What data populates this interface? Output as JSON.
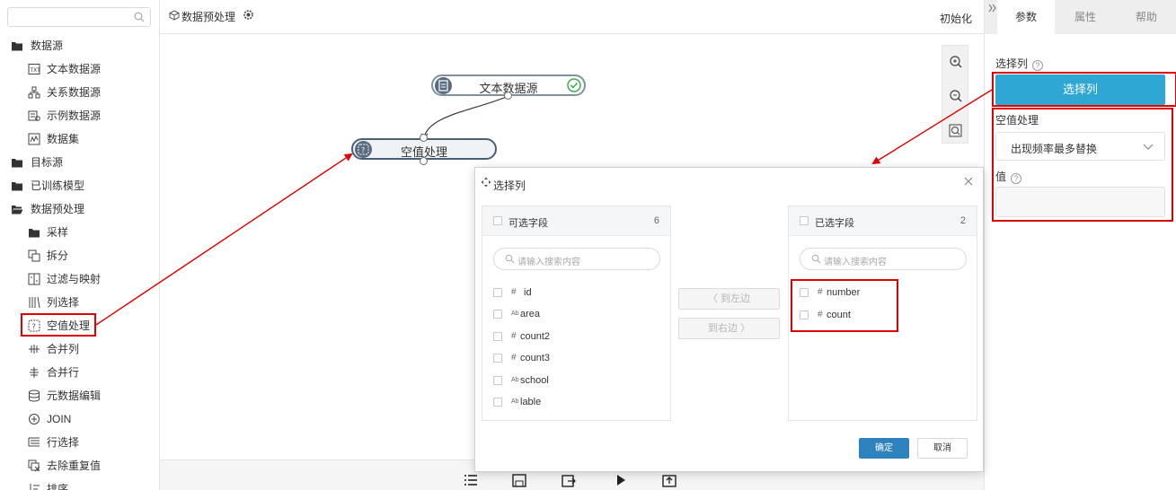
{
  "sidebar": {
    "search_placeholder": "",
    "items": [
      {
        "label": "数据源",
        "icon": "folder-icon"
      },
      {
        "label": "文本数据源",
        "icon": "text-file-icon"
      },
      {
        "label": "关系数据源",
        "icon": "relation-icon"
      },
      {
        "label": "示例数据源",
        "icon": "sample-data-icon"
      },
      {
        "label": "数据集",
        "icon": "dataset-icon"
      },
      {
        "label": "目标源",
        "icon": "folder-icon"
      },
      {
        "label": "已训练模型",
        "icon": "folder-icon"
      },
      {
        "label": "数据预处理",
        "icon": "folder-icon"
      },
      {
        "label": "采样",
        "icon": "folder-icon"
      },
      {
        "label": "拆分",
        "icon": "split-icon"
      },
      {
        "label": "过滤与映射",
        "icon": "filter-map-icon"
      },
      {
        "label": "列选择",
        "icon": "column-select-icon"
      },
      {
        "label": "空值处理",
        "icon": "null-handling-icon"
      },
      {
        "label": "合并列",
        "icon": "merge-columns-icon"
      },
      {
        "label": "合并行",
        "icon": "merge-rows-icon"
      },
      {
        "label": "元数据编辑",
        "icon": "metadata-icon"
      },
      {
        "label": "JOIN",
        "icon": "join-icon"
      },
      {
        "label": "行选择",
        "icon": "row-select-icon"
      },
      {
        "label": "去除重复值",
        "icon": "dedupe-icon"
      },
      {
        "label": "排序",
        "icon": "sort-icon"
      }
    ]
  },
  "topbar": {
    "title": "数据预处理",
    "init_label": "初始化"
  },
  "canvas": {
    "nodes": [
      {
        "label": "文本数据源"
      },
      {
        "label": "空值处理"
      }
    ]
  },
  "right_panel": {
    "tabs": [
      "参数",
      "属性",
      "帮助"
    ],
    "active_tab": "参数",
    "select_col_label": "选择列",
    "select_col_button": "选择列",
    "null_handling_label": "空值处理",
    "null_handling_value": "出现频率最多替换",
    "value_label": "值",
    "value": "",
    "help_glyph": "?"
  },
  "dialog": {
    "title": "选择列",
    "available": {
      "title": "可选字段",
      "count": "6",
      "search_placeholder": "请输入搜索内容",
      "fields": [
        {
          "type": "#",
          "name": "id"
        },
        {
          "type": "Ab",
          "name": "area"
        },
        {
          "type": "#",
          "name": "count2"
        },
        {
          "type": "#",
          "name": "count3"
        },
        {
          "type": "Ab",
          "name": "school"
        },
        {
          "type": "Ab",
          "name": "lable"
        }
      ]
    },
    "selected": {
      "title": "已选字段",
      "count": "2",
      "search_placeholder": "请输入搜索内容",
      "fields": [
        {
          "type": "#",
          "name": "number"
        },
        {
          "type": "#",
          "name": "count"
        }
      ]
    },
    "to_left": "〈 到左边",
    "to_right": "到右边 〉",
    "ok": "确定",
    "cancel": "取消"
  },
  "colors": {
    "accent": "#2ea7d5",
    "primary_button": "#2e83bf",
    "highlight": "#e00000",
    "node_border": "#7f90a0"
  }
}
